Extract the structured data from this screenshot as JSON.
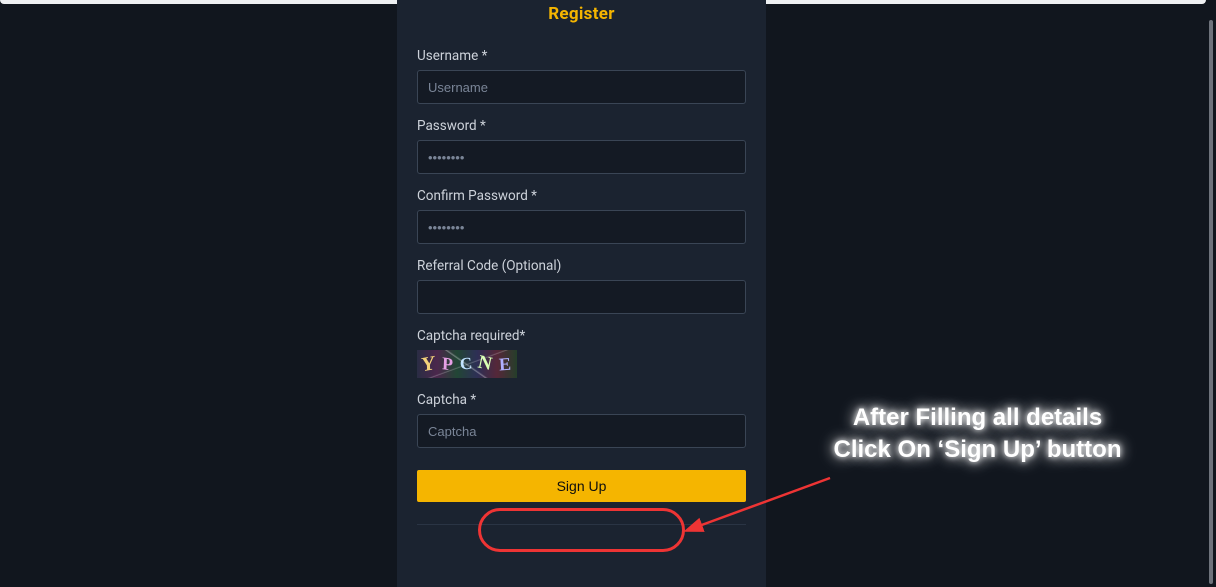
{
  "form": {
    "title": "Register",
    "fields": {
      "username": {
        "label": "Username *",
        "placeholder": "Username",
        "value": ""
      },
      "password": {
        "label": "Password *",
        "placeholder": "••••••••",
        "value": ""
      },
      "confirm_password": {
        "label": "Confirm Password *",
        "placeholder": "••••••••",
        "value": ""
      },
      "referral": {
        "label": "Referral Code (Optional)",
        "placeholder": "",
        "value": ""
      },
      "captcha_required": {
        "label": "Captcha required*",
        "image_text": "YPCNE"
      },
      "captcha": {
        "label": "Captcha *",
        "placeholder": "Captcha",
        "value": ""
      }
    },
    "submit_label": "Sign Up"
  },
  "annotation": {
    "line1": "After Filling all details",
    "line2": "Click On ‘Sign Up’ button"
  },
  "colors": {
    "accent": "#f5b500",
    "panel_bg": "#1b2330",
    "page_bg": "#11161e",
    "annotation_red": "#ee3434"
  }
}
